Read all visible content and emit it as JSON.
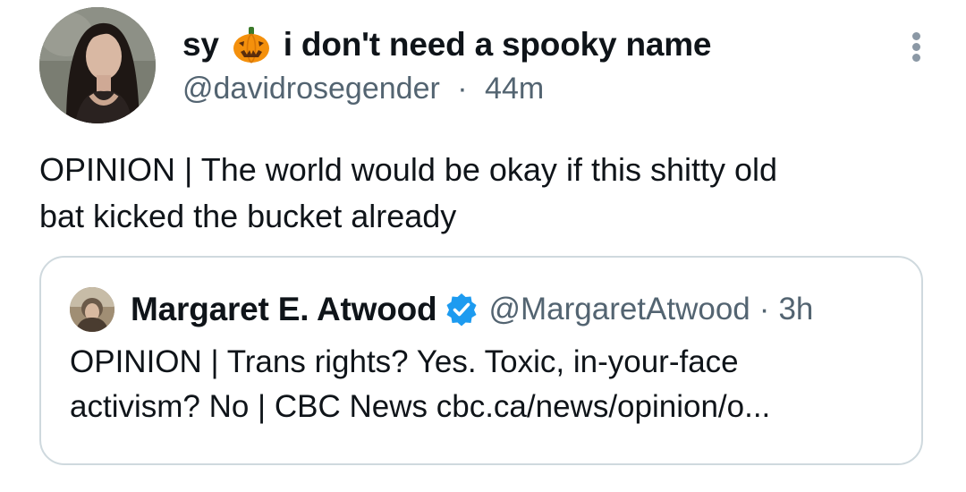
{
  "tweet": {
    "display_name_part1": "sy",
    "display_name_emoji": "pumpkin-emoji",
    "display_name_part2": "i don't need a spooky name",
    "handle": "@davidrosegender",
    "separator": "·",
    "time": "44m",
    "text_line1": "OPINION | The world would be okay if this shitty old",
    "text_line2": "bat kicked the bucket already"
  },
  "quote": {
    "display_name": "Margaret E. Atwood",
    "verified": true,
    "handle": "@MargaretAtwood",
    "separator": "·",
    "time": "3h",
    "text_line1": "OPINION | Trans rights? Yes. Toxic, in-your-face",
    "text_line2": "activism? No | CBC News cbc.ca/news/opinion/o..."
  },
  "colors": {
    "text_primary": "#0f1419",
    "text_secondary": "#536471",
    "border": "#cfd9de",
    "verified_blue": "#1d9bf0",
    "pumpkin_orange": "#f4900c"
  },
  "icons": {
    "more": "vertical-ellipsis-icon",
    "verified": "verified-badge-icon"
  }
}
